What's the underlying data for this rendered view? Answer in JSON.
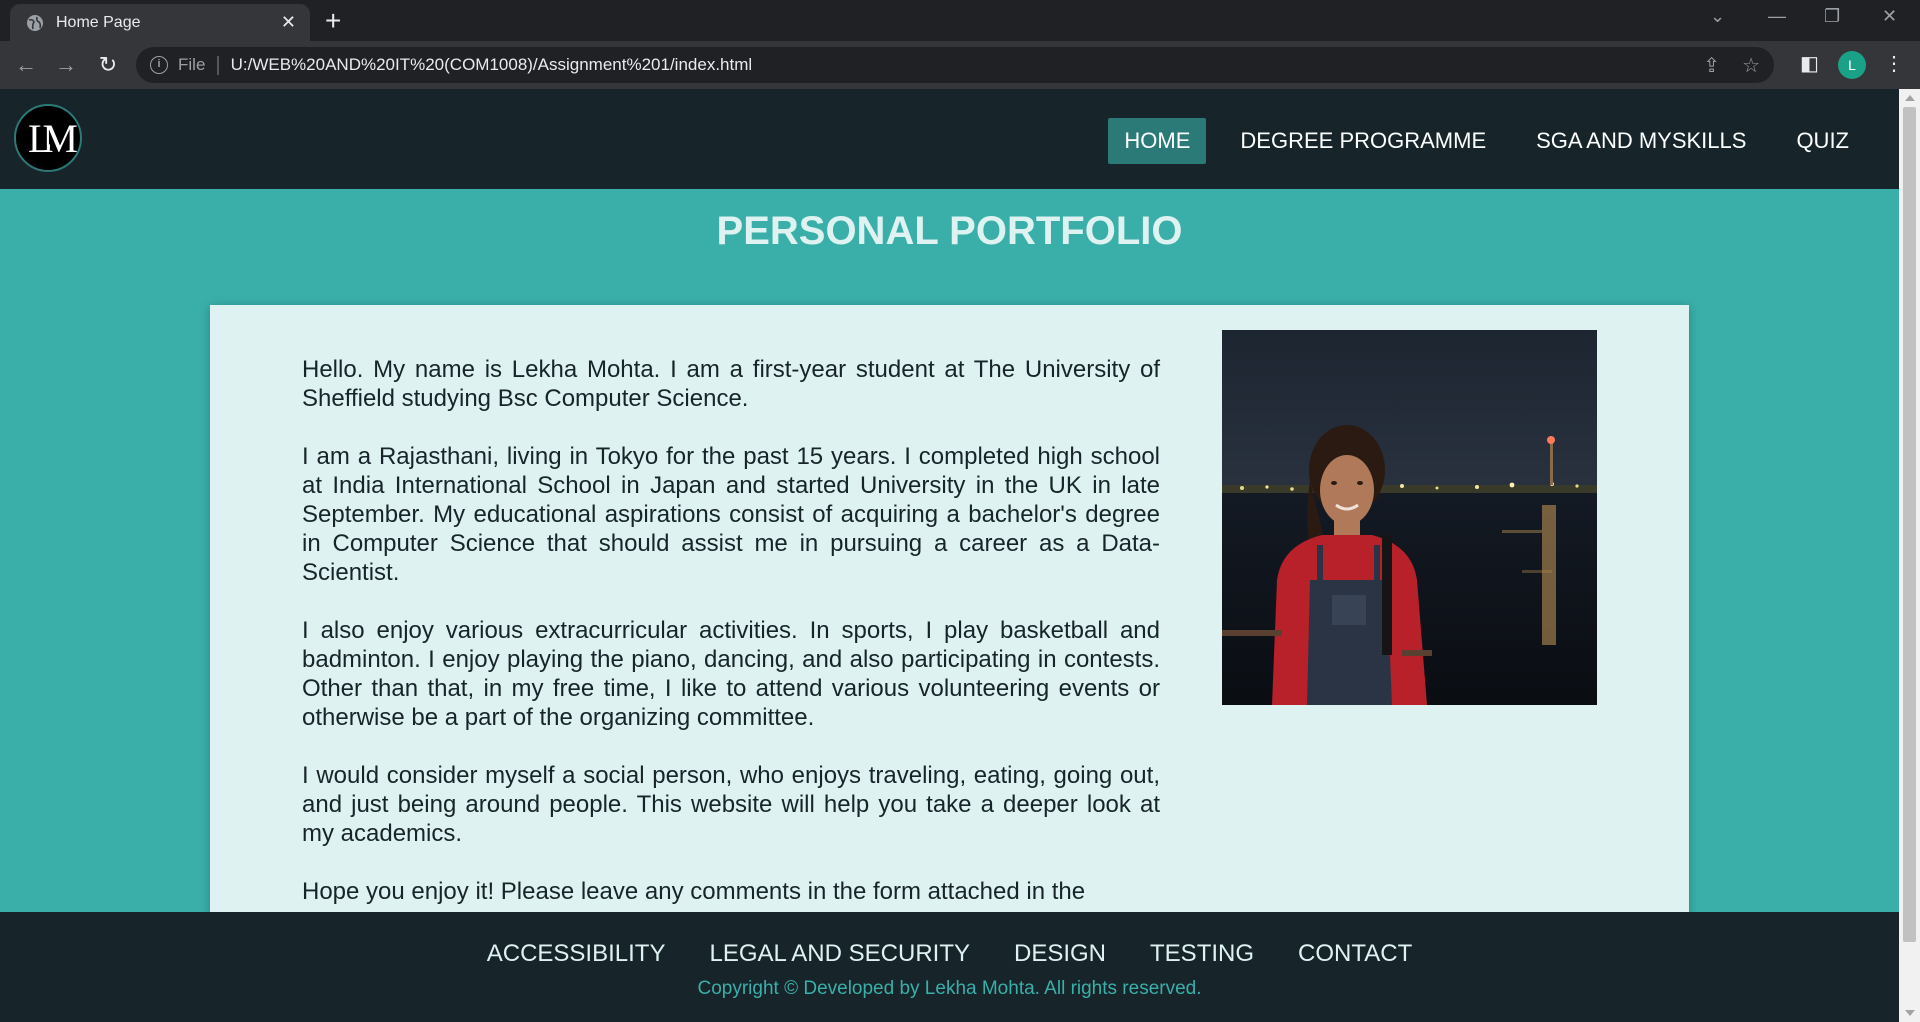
{
  "browser": {
    "tab_title": "Home Page",
    "url_scheme_label": "File",
    "url": "U:/WEB%20AND%20IT%20(COM1008)/Assignment%201/index.html",
    "profile_initial": "L"
  },
  "site": {
    "logo_text": "LM",
    "nav": [
      {
        "label": "HOME",
        "active": true
      },
      {
        "label": "DEGREE PROGRAMME",
        "active": false
      },
      {
        "label": "SGA AND MYSKILLS",
        "active": false
      },
      {
        "label": "QUIZ",
        "active": false
      }
    ],
    "page_title": "PERSONAL PORTFOLIO",
    "paragraphs": [
      "Hello. My name is Lekha Mohta. I am a first-year student at The University of Sheffield studying Bsc Computer Science.",
      "I am a Rajasthani, living in Tokyo for the past 15 years. I completed high school at India International School in Japan and started University in the UK in late September. My educational aspirations consist of acquiring a bachelor's degree in Computer Science that should assist me in pursuing a career as a Data-Scientist.",
      "I also enjoy various extracurricular activities. In sports, I play basketball and badminton. I enjoy playing the piano, dancing, and also participating in contests. Other than that, in my free time, I like to attend various volunteering events or otherwise be a part of the organizing committee.",
      "I would consider myself a social person, who enjoys traveling, eating, going out, and just being around people. This website will help you take a deeper look at my academics.",
      "Hope you enjoy it! Please leave any comments in the form attached in the"
    ],
    "footer_links": [
      "ACCESSIBILITY",
      "LEGAL AND SECURITY",
      "DESIGN",
      "TESTING",
      "CONTACT"
    ],
    "copyright": "Copyright © Developed by Lekha Mohta. All rights reserved."
  },
  "colors": {
    "header_bg": "#17252a",
    "page_bg": "#3aafa9",
    "active_nav": "#2b7a78",
    "card_bg": "#def2f1"
  }
}
